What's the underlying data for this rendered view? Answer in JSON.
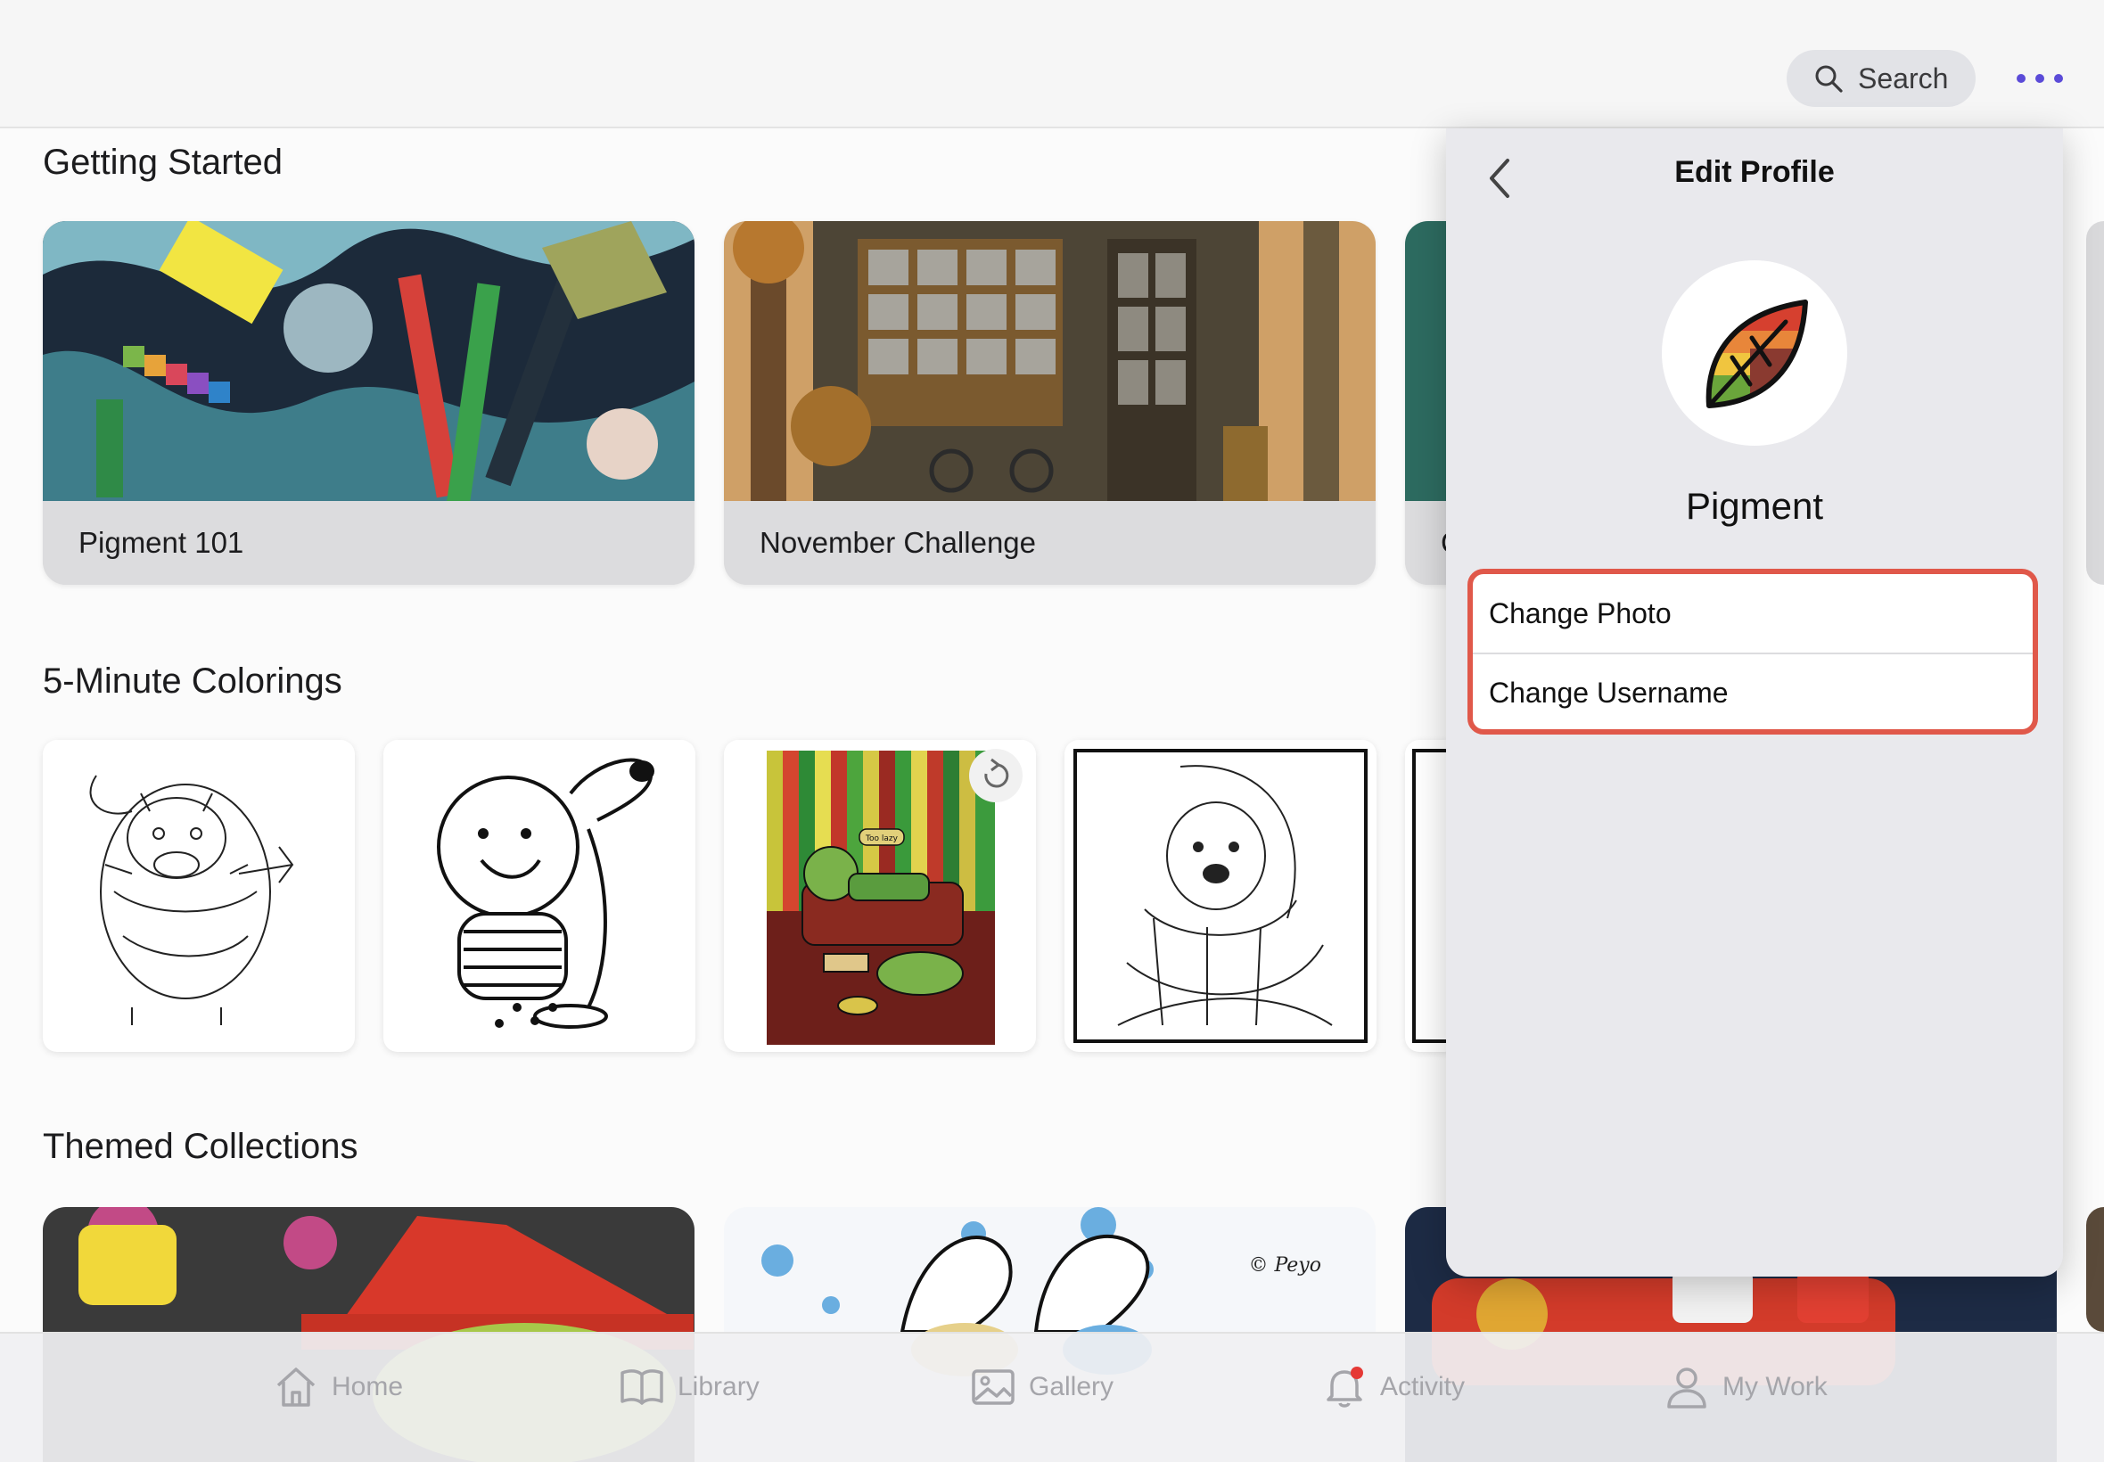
{
  "topbar": {
    "search_label": "Search",
    "search_icon": "magnifier-icon",
    "more_icon": "ellipsis-icon",
    "accent_color": "#5b4bd8"
  },
  "sections": {
    "getting_started": "Getting Started",
    "five_minute": "5-Minute Colorings",
    "themed": "Themed Collections"
  },
  "getting_started_cards": [
    {
      "label": "Pigment 101"
    },
    {
      "label": "November Challenge"
    },
    {
      "label": "C"
    }
  ],
  "coloring_thumbs": [
    {
      "name": "dog-with-flower"
    },
    {
      "name": "boy-and-dog"
    },
    {
      "name": "girl-on-sofa",
      "badge": "Too lazy"
    },
    {
      "name": "dog-with-scarf"
    }
  ],
  "themed_cards": [
    {
      "name": "witch-hat"
    },
    {
      "name": "smurfs",
      "credit": "© Peyo"
    },
    {
      "name": "car-illustration"
    }
  ],
  "popover": {
    "title": "Edit Profile",
    "back_icon": "chevron-left-icon",
    "avatar_icon": "leaf-logo-icon",
    "username": "Pigment",
    "options": [
      {
        "label": "Change Photo"
      },
      {
        "label": "Change Username"
      }
    ],
    "highlight_color": "#e0584a"
  },
  "tabbar": {
    "tabs": [
      {
        "label": "Home",
        "icon": "house-icon"
      },
      {
        "label": "Library",
        "icon": "book-icon"
      },
      {
        "label": "Gallery",
        "icon": "image-icon"
      },
      {
        "label": "Activity",
        "icon": "bell-icon"
      },
      {
        "label": "My Work",
        "icon": "person-icon"
      }
    ],
    "activity_badge_color": "#e53935"
  }
}
